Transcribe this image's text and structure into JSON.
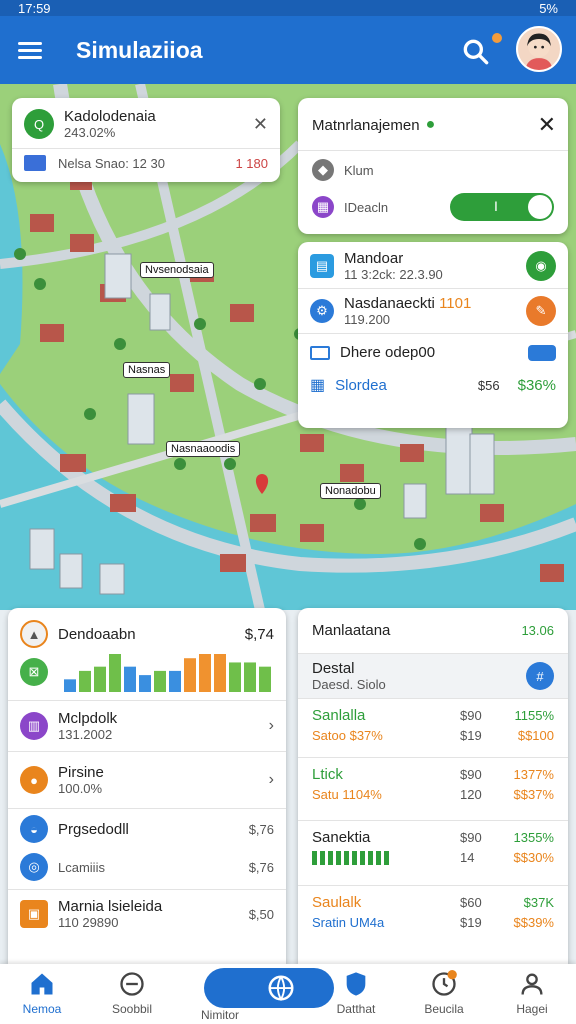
{
  "status": {
    "time": "17:59",
    "battery": "5%"
  },
  "app": {
    "title": "Simulaziioa"
  },
  "map_labels": [
    "Nvsenodsaia",
    "Nasnas",
    "Nasnaaoodis",
    "Nonadobu"
  ],
  "top_left_card": {
    "title": "Kadolodenaia",
    "value": "243.02%",
    "sub": "Nelsa Snao: 12 30",
    "sub_value": "1 180"
  },
  "mgmt_card": {
    "title": "Matnrlanajemen",
    "row1": "Klum",
    "row2": "IDeacln",
    "toggle_label": "I"
  },
  "mid_card": {
    "items": [
      {
        "title": "Mandoar",
        "sub": "11 3:2ck: 22.3.90"
      },
      {
        "title": "Nasdanaeckti",
        "badge": "1101",
        "sub": "119.200"
      }
    ],
    "input_label": "Dhere odep00",
    "action_label": "Slordea",
    "action_value": "$56",
    "action_pct": "$36%"
  },
  "left_panel": {
    "header_title": "Dendoaabn",
    "header_value": "$,74",
    "chart_data": {
      "type": "bar",
      "values": [
        3,
        5,
        6,
        9,
        6,
        4,
        5,
        5,
        8,
        9,
        9,
        7,
        7,
        6
      ],
      "colors": [
        "#3a8fe0",
        "#6fbf4a",
        "#6fbf4a",
        "#6fbf4a",
        "#3a8fe0",
        "#3a8fe0",
        "#6fbf4a",
        "#3a8fe0",
        "#f0922f",
        "#f0922f",
        "#f0922f",
        "#6fbf4a",
        "#6fbf4a",
        "#6fbf4a"
      ]
    },
    "rows": [
      {
        "title": "Mclpdolk",
        "sub": "131.2002"
      },
      {
        "title": "Pirsine",
        "sub": "100.0%"
      },
      {
        "title": "Prgsedodll",
        "value": "$,76"
      },
      {
        "title": "Lcamiiis",
        "value": "$,76"
      },
      {
        "title": "Marnia lsieleida",
        "sub": "110 29890",
        "value": "$,50"
      }
    ]
  },
  "right_panel": {
    "title": "Manlaatana",
    "value": "13.06",
    "detail_title": "Destal",
    "detail_sub": "Daesd. Siolo",
    "detail_btn": "#",
    "rows": [
      {
        "a": "Sanlalla",
        "b": "$90",
        "c": "1155%",
        "d": "Satoo $37%",
        "e": "$19",
        "f": "$$100"
      },
      {
        "a": "Ltick",
        "b": "$90",
        "c": "1377%",
        "d": "Satu 1104%",
        "e": "120",
        "f": "$$37%"
      },
      {
        "a": "Sanektia",
        "b": "$90",
        "c": "1355%",
        "e": "14",
        "f": "$$30%"
      },
      {
        "a": "Saulalk",
        "b": "$60",
        "c": "$37K",
        "d": "Sratin UM4a",
        "e": "$19",
        "f": "$$39%"
      }
    ]
  },
  "nav": [
    {
      "label": "Nemoa"
    },
    {
      "label": "Soobbil"
    },
    {
      "label": "Nimitor"
    },
    {
      "label": "Datthat"
    },
    {
      "label": "Beucila"
    },
    {
      "label": "Hagei"
    }
  ]
}
